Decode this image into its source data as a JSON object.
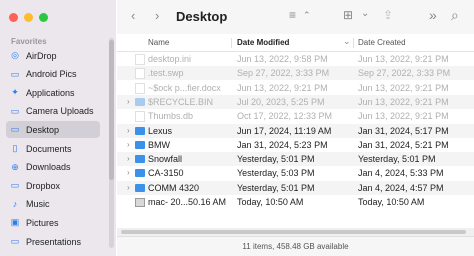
{
  "window": {
    "title": "Desktop"
  },
  "sidebar": {
    "section": "Favorites",
    "items": [
      {
        "label": "AirDrop",
        "icon": "airdrop-icon",
        "glyph": "◎"
      },
      {
        "label": "Android Pics",
        "icon": "folder-icon",
        "glyph": "▭"
      },
      {
        "label": "Applications",
        "icon": "applications-icon",
        "glyph": "✦"
      },
      {
        "label": "Camera Uploads",
        "icon": "folder-icon",
        "glyph": "▭"
      },
      {
        "label": "Desktop",
        "icon": "desktop-icon",
        "glyph": "▭",
        "selected": true
      },
      {
        "label": "Documents",
        "icon": "document-icon",
        "glyph": "▯"
      },
      {
        "label": "Downloads",
        "icon": "downloads-icon",
        "glyph": "⊕"
      },
      {
        "label": "Dropbox",
        "icon": "folder-icon",
        "glyph": "▭"
      },
      {
        "label": "Music",
        "icon": "music-icon",
        "glyph": "♪"
      },
      {
        "label": "Pictures",
        "icon": "pictures-icon",
        "glyph": "▣"
      },
      {
        "label": "Presentations",
        "icon": "folder-icon",
        "glyph": "▭"
      }
    ]
  },
  "toolbar": {
    "back": "‹",
    "forward": "›",
    "list_view": "≡",
    "sort": "⌃",
    "grid": "⊞",
    "grid_chevron": "⌄",
    "share": "⇪",
    "more": "»",
    "search": "⌕"
  },
  "columns": {
    "name": "Name",
    "modified": "Date Modified",
    "created": "Date Created",
    "sort_indicator": "⌄"
  },
  "files": [
    {
      "name": "desktop.ini",
      "modified": "Jun 13, 2022, 9:58 PM",
      "created": "Jun 13, 2022, 9:21 PM",
      "kind": "doc",
      "dim": true,
      "disclosure": false
    },
    {
      "name": ".test.swp",
      "modified": "Sep 27, 2022, 3:33 PM",
      "created": "Sep 27, 2022, 3:33 PM",
      "kind": "doc",
      "dim": true,
      "disclosure": false
    },
    {
      "name": "~$ock p...fier.docx",
      "modified": "Jun 13, 2022, 9:21 PM",
      "created": "Jun 13, 2022, 9:21 PM",
      "kind": "doc",
      "dim": true,
      "disclosure": false
    },
    {
      "name": "$RECYCLE.BIN",
      "modified": "Jul 20, 2023, 5:25 PM",
      "created": "Jun 13, 2022, 9:21 PM",
      "kind": "folder",
      "dim": true,
      "disclosure": true
    },
    {
      "name": "Thumbs.db",
      "modified": "Oct 17, 2022, 12:33 PM",
      "created": "Jun 13, 2022, 9:21 PM",
      "kind": "doc",
      "dim": true,
      "disclosure": false
    },
    {
      "name": "Lexus",
      "modified": "Jun 17, 2024, 11:19 AM",
      "created": "Jan 31, 2024, 5:17 PM",
      "kind": "folder",
      "dim": false,
      "disclosure": true
    },
    {
      "name": "BMW",
      "modified": "Jan 31, 2024, 5:23 PM",
      "created": "Jan 31, 2024, 5:21 PM",
      "kind": "folder",
      "dim": false,
      "disclosure": true
    },
    {
      "name": "Snowfall",
      "modified": "Yesterday, 5:01 PM",
      "created": "Yesterday, 5:01 PM",
      "kind": "folder",
      "dim": false,
      "disclosure": true
    },
    {
      "name": "CA-3150",
      "modified": "Yesterday, 5:03 PM",
      "created": "Jan 4, 2024, 5:33 PM",
      "kind": "folder",
      "dim": false,
      "disclosure": true
    },
    {
      "name": "COMM 4320",
      "modified": "Yesterday, 5:01 PM",
      "created": "Jan 4, 2024, 4:57 PM",
      "kind": "folder",
      "dim": false,
      "disclosure": true
    },
    {
      "name": "mac- 20...50.16 AM",
      "modified": "Today, 10:50 AM",
      "created": "Today, 10:50 AM",
      "kind": "image",
      "dim": false,
      "disclosure": false
    }
  ],
  "status": "11 items, 458.48 GB available",
  "colors": {
    "accent": "#2b7de9",
    "folder": "#3b92e8",
    "sidebar_bg": "#ebe7ed"
  }
}
